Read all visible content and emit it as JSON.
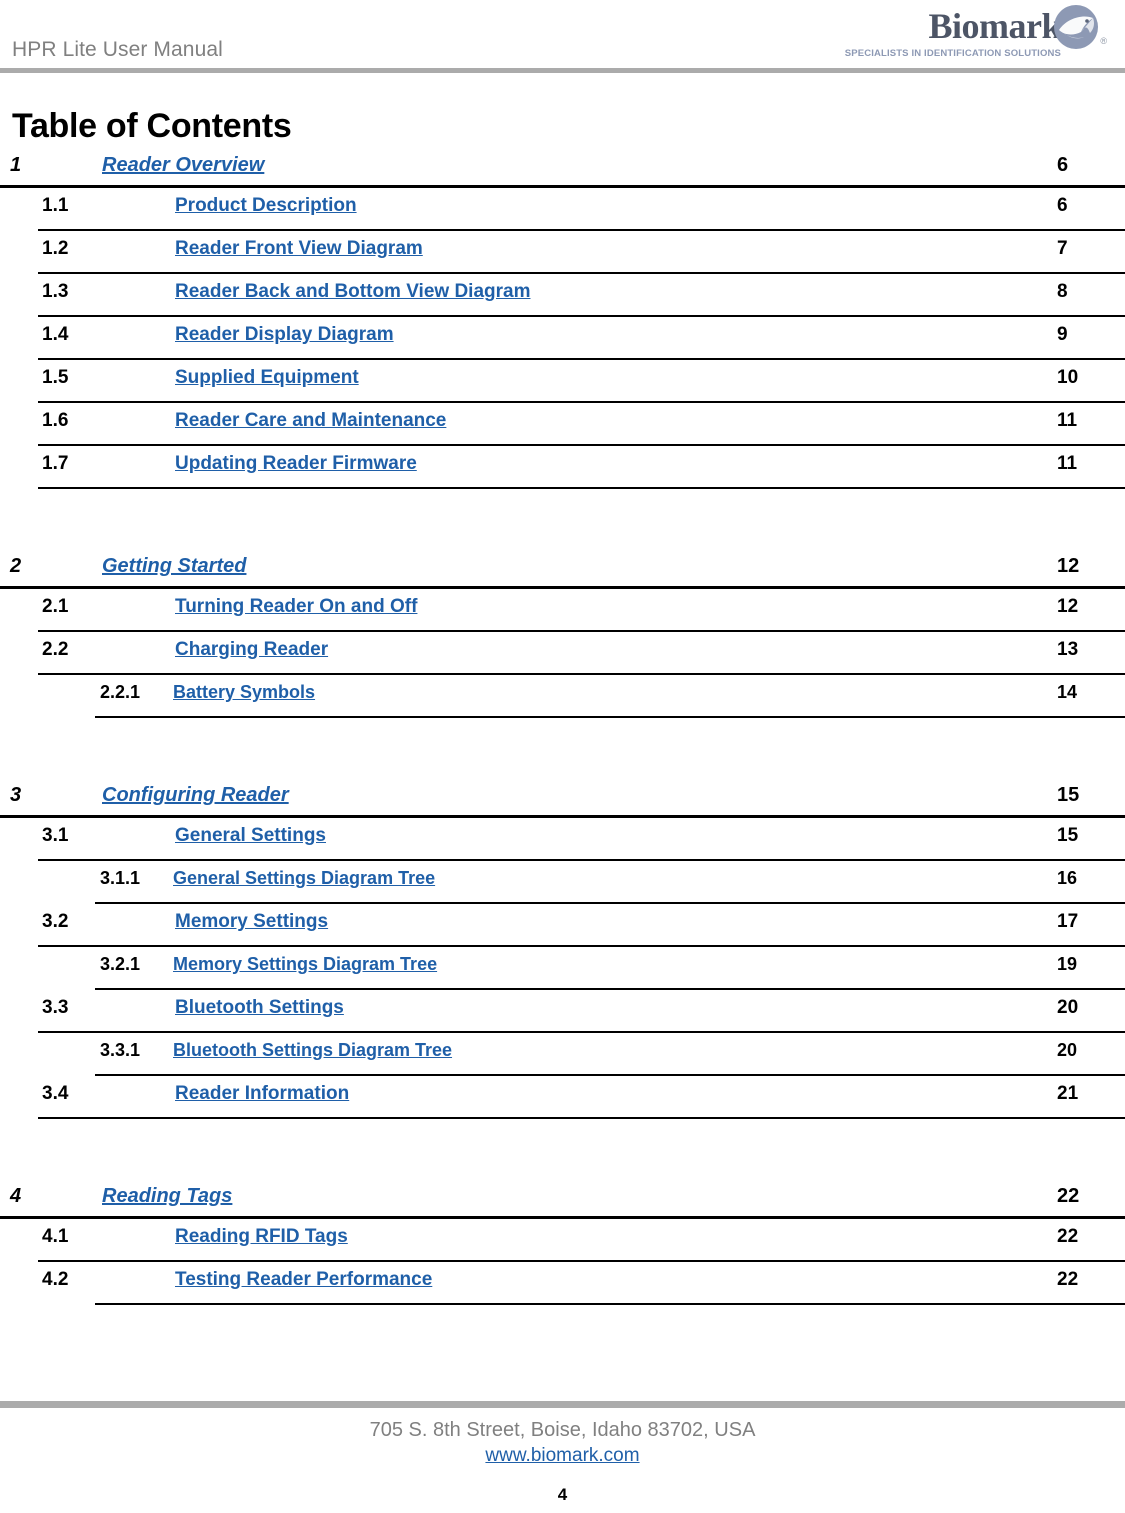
{
  "header": {
    "document_title": "HPR Lite User Manual",
    "logo": {
      "wordmark": "Biomark",
      "registered_mark": "®",
      "tagline": "SPECIALISTS IN IDENTIFICATION SOLUTIONS",
      "icon": "fish-in-circle-icon"
    }
  },
  "page": {
    "title": "Table of Contents"
  },
  "colors": {
    "link": "#1F5FA8",
    "rule_gray": "#ABABAB",
    "text_gray": "#808080",
    "logo_wordmark": "#4D5566",
    "logo_tagline": "#8D99B4"
  },
  "toc": {
    "groups": [
      {
        "entries": [
          {
            "level": 1,
            "number": "1",
            "title": "Reader Overview",
            "page": "6"
          },
          {
            "level": 2,
            "number": "1.1",
            "title": "Product Description",
            "page": "6"
          },
          {
            "level": 2,
            "number": "1.2",
            "title": "Reader Front View Diagram",
            "page": "7"
          },
          {
            "level": 2,
            "number": "1.3",
            "title": "Reader Back and Bottom View Diagram",
            "page": "8"
          },
          {
            "level": 2,
            "number": "1.4",
            "title": "Reader Display Diagram",
            "page": "9"
          },
          {
            "level": 2,
            "number": "1.5",
            "title": "Supplied Equipment",
            "page": "10"
          },
          {
            "level": 2,
            "number": "1.6",
            "title": "Reader Care and Maintenance",
            "page": "11"
          },
          {
            "level": 2,
            "number": "1.7",
            "title": "Updating Reader Firmware",
            "page": "11"
          }
        ]
      },
      {
        "entries": [
          {
            "level": 1,
            "number": "2",
            "title": "Getting Started",
            "page": "12"
          },
          {
            "level": 2,
            "number": "2.1",
            "title": "Turning Reader On and Off",
            "page": "12"
          },
          {
            "level": 2,
            "number": "2.2",
            "title": "Charging Reader",
            "page": "13"
          },
          {
            "level": 3,
            "number": "2.2.1",
            "title": "Battery Symbols",
            "page": "14"
          }
        ]
      },
      {
        "entries": [
          {
            "level": 1,
            "number": "3",
            "title": "Configuring Reader",
            "page": "15"
          },
          {
            "level": 2,
            "number": "3.1",
            "title": "General Settings",
            "page": "15"
          },
          {
            "level": 3,
            "number": "3.1.1",
            "title": "General Settings Diagram Tree",
            "page": "16"
          },
          {
            "level": 2,
            "number": "3.2",
            "title": "Memory Settings",
            "page": "17"
          },
          {
            "level": 3,
            "number": "3.2.1",
            "title": "Memory Settings Diagram Tree",
            "page": "19"
          },
          {
            "level": 2,
            "number": "3.3",
            "title": "Bluetooth Settings",
            "page": "20"
          },
          {
            "level": 3,
            "number": "3.3.1",
            "title": "Bluetooth Settings Diagram Tree",
            "page": "20"
          },
          {
            "level": 2,
            "number": "3.4",
            "title": "Reader Information",
            "page": "21"
          }
        ]
      },
      {
        "entries": [
          {
            "level": 1,
            "number": "4",
            "title": "Reading Tags",
            "page": "22"
          },
          {
            "level": 2,
            "number": "4.1",
            "title": "Reading RFID Tags",
            "page": "22"
          },
          {
            "level": 2,
            "number": "4.2",
            "title": "Testing Reader Performance",
            "page": "22",
            "indent_separator": true
          }
        ]
      }
    ]
  },
  "footer": {
    "address": "705 S. 8th Street, Boise, Idaho 83702, USA",
    "url": "www.biomark.com",
    "page_number": "4"
  }
}
